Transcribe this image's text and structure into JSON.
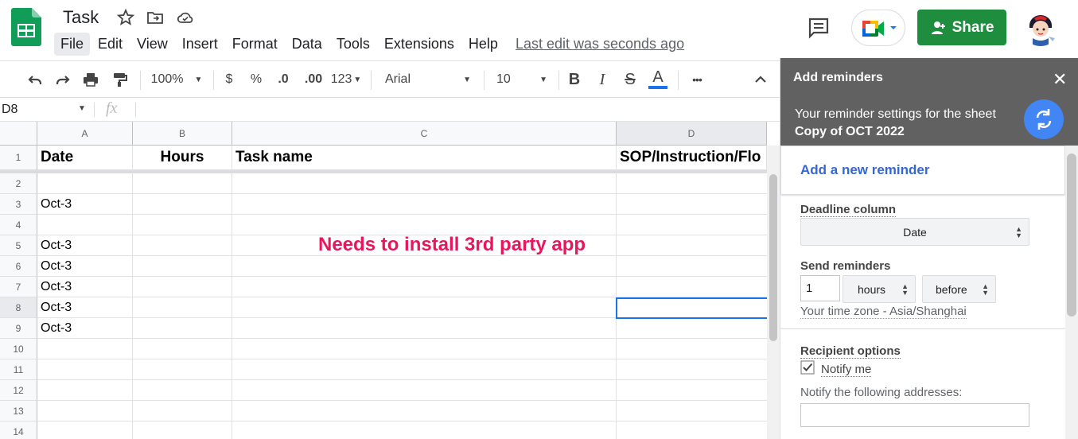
{
  "app": {
    "title": "Task",
    "menu": [
      "File",
      "Edit",
      "View",
      "Insert",
      "Format",
      "Data",
      "Tools",
      "Extensions",
      "Help"
    ],
    "last_edit": "Last edit was seconds ago",
    "share_label": "Share",
    "brand_green": "#1e8e3e"
  },
  "toolbar": {
    "zoom": "100%",
    "currency": "$",
    "percent": "%",
    "dec_decrease": ".0",
    "dec_increase": ".00",
    "number_format": "123",
    "font": "Arial",
    "font_size": "10",
    "bold": "B",
    "italic": "I",
    "strike": "S",
    "text_color": "A",
    "more": "•••"
  },
  "formula": {
    "name_box": "D8",
    "fx": "fx",
    "value": ""
  },
  "sheet": {
    "columns": [
      "A",
      "B",
      "C",
      "D"
    ],
    "rows": [
      "1",
      "2",
      "3",
      "4",
      "5",
      "6",
      "7",
      "8",
      "9",
      "10",
      "11",
      "12",
      "13",
      "14"
    ],
    "header": [
      "Date",
      "Hours",
      "Task name",
      "SOP/Instruction/Flo"
    ],
    "col_a": [
      "",
      "Oct-3",
      "",
      "Oct-3",
      "Oct-3",
      "Oct-3",
      "Oct-3",
      "Oct-3",
      "",
      "",
      "",
      "",
      ""
    ],
    "selected_cell": "D8",
    "annotation": "Needs to install 3rd party app",
    "annotation_color": "#e8175d"
  },
  "panel": {
    "title": "Add reminders",
    "close": "✕",
    "subtitle": "Your reminder settings for the sheet",
    "sheet_name": "Copy of OCT 2022",
    "add_new": "Add a new reminder",
    "deadline_label": "Deadline column",
    "deadline_value": "Date",
    "send_label": "Send reminders",
    "send_amount": "1",
    "send_unit": "hours",
    "send_when": "before",
    "timezone": "Your time zone - Asia/Shanghai",
    "recipient_label": "Recipient options",
    "notify_me": "Notify me",
    "notify_me_checked": true,
    "notify_addresses_label": "Notify the following addresses:",
    "notify_addresses_value": "",
    "header_color": "#616161",
    "link_color": "#3367d6"
  }
}
